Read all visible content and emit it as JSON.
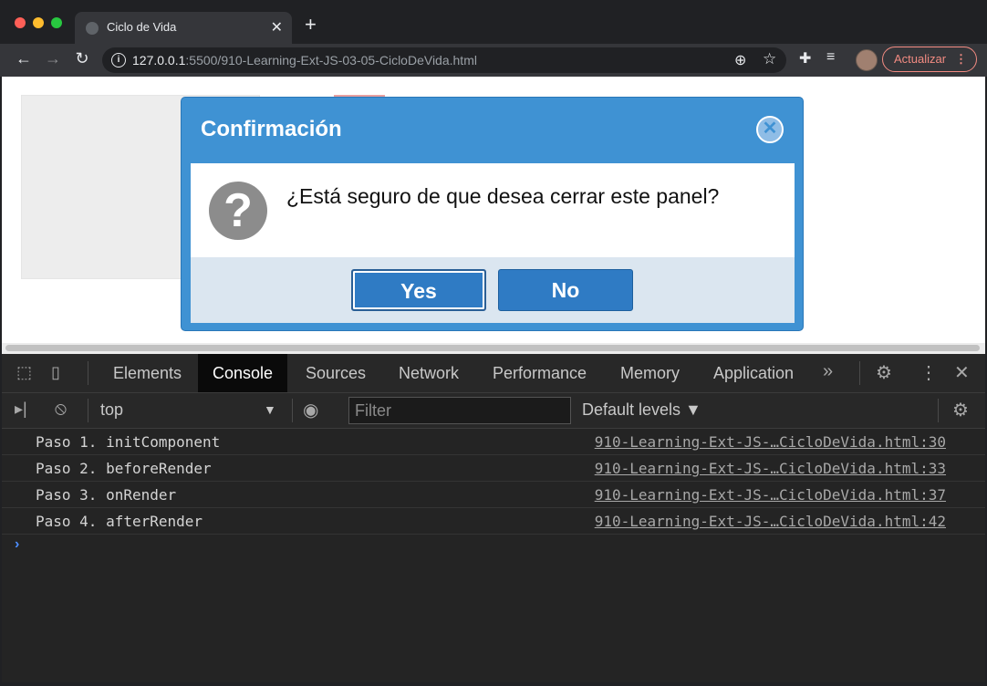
{
  "browser": {
    "tab_title": "Ciclo de Vida",
    "url_host": "127.0.0.1",
    "url_rest": ":5500/910-Learning-Ext-JS-03-05-CicloDeVida.html",
    "update_label": "Actualizar"
  },
  "dialog": {
    "title": "Confirmación",
    "message": "¿Está seguro de que desea cerrar este panel?",
    "yes_label": "Yes",
    "no_label": "No"
  },
  "devtools": {
    "tabs": [
      "Elements",
      "Console",
      "Sources",
      "Network",
      "Performance",
      "Memory",
      "Application"
    ],
    "active_tab": "Console",
    "context": "top",
    "filter_placeholder": "Filter",
    "levels_label": "Default levels ▼",
    "logs": [
      {
        "message": "Paso 1. initComponent",
        "source": "910-Learning-Ext-JS-…CicloDeVida.html:30"
      },
      {
        "message": "Paso 2. beforeRender",
        "source": "910-Learning-Ext-JS-…CicloDeVida.html:33"
      },
      {
        "message": "Paso 3. onRender",
        "source": "910-Learning-Ext-JS-…CicloDeVida.html:37"
      },
      {
        "message": "Paso 4. afterRender",
        "source": "910-Learning-Ext-JS-…CicloDeVida.html:42"
      }
    ]
  },
  "colors": {
    "dialog_blue": "#3f92d3",
    "button_blue": "#2f7bc4",
    "update_accent": "#f28b82"
  }
}
